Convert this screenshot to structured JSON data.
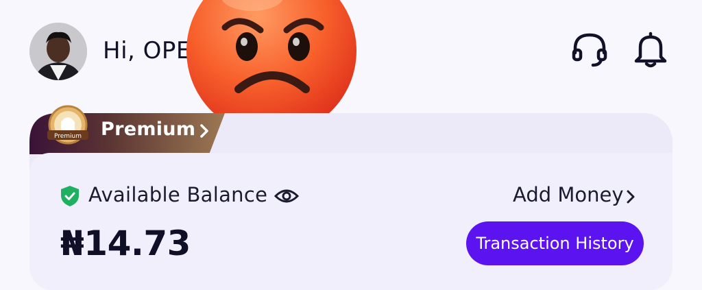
{
  "header": {
    "greeting": "Hi, OPE",
    "icons": [
      "avatar",
      "angry-face-emoji",
      "headset-icon",
      "bell-icon"
    ]
  },
  "card": {
    "premium_label": "Premium",
    "medal_text": "Premium",
    "balance_label": "Available Balance",
    "balance_value": "₦14.73",
    "add_money_label": "Add Money",
    "transaction_button": "Transaction History",
    "icons": [
      "shield-check-icon",
      "eye-icon",
      "chevron-right-icon"
    ]
  },
  "colors": {
    "accent": "#5b14f0",
    "shield_green": "#1fb061",
    "card_bg": "#ece9f9",
    "premium_tab": "#6e4a3c"
  }
}
